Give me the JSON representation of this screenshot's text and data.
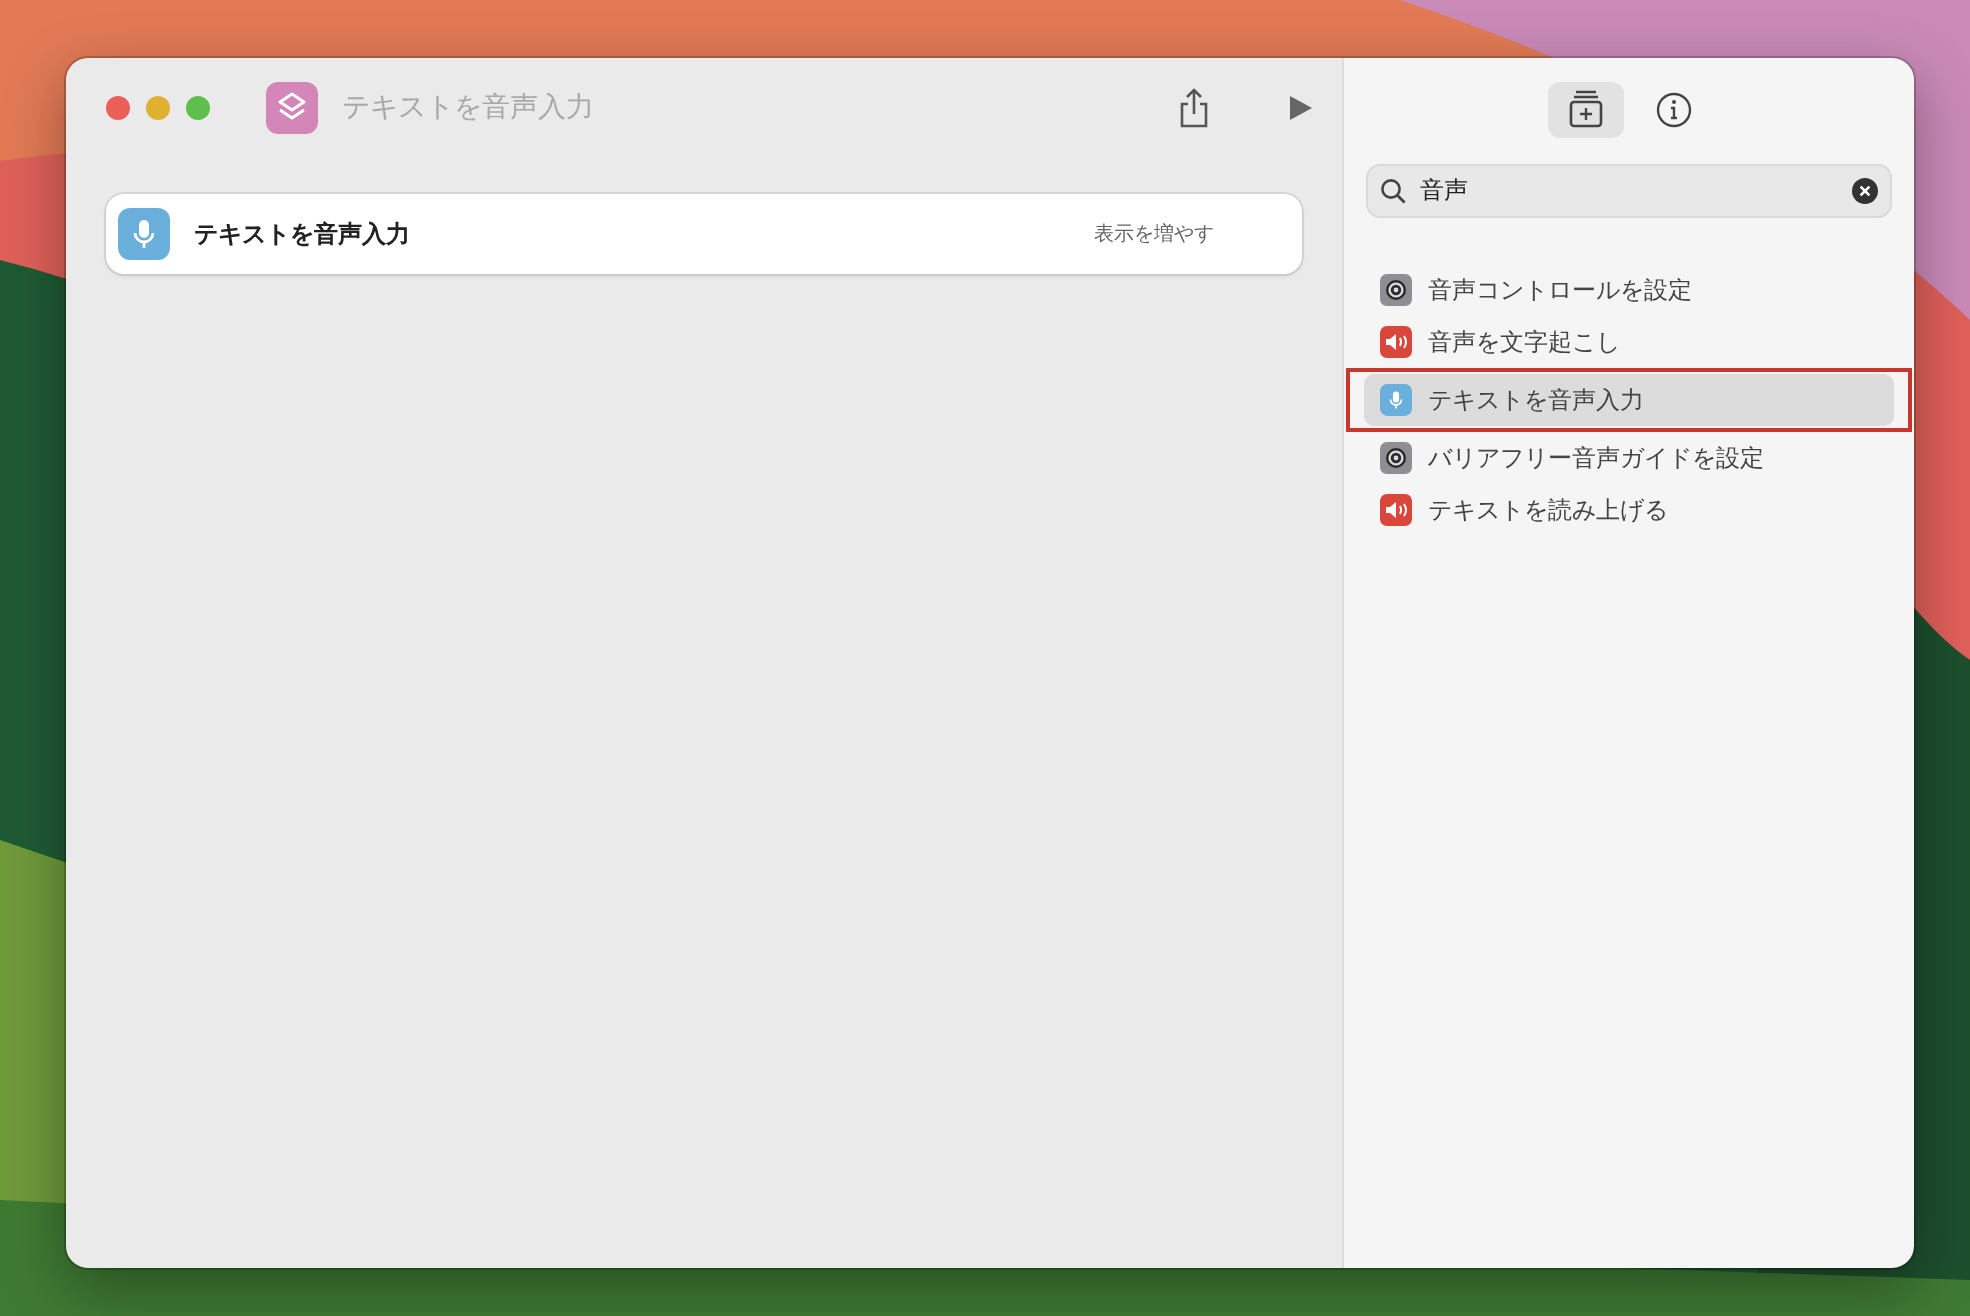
{
  "window": {
    "title": "テキストを音声入力"
  },
  "editor": {
    "actions": [
      {
        "title": "テキストを音声入力",
        "kind": "mic",
        "more": "表示を増やす"
      }
    ]
  },
  "sidebar": {
    "tabs": [
      {
        "kind": "library",
        "selected": true
      },
      {
        "kind": "info",
        "selected": false
      }
    ],
    "search": {
      "value": "音声"
    },
    "results": [
      {
        "label": "音声コントロールを設定",
        "kind": "gear",
        "selected": false,
        "annotated": false
      },
      {
        "label": "音声を文字起こし",
        "kind": "speaker",
        "selected": false,
        "annotated": false
      },
      {
        "label": "テキストを音声入力",
        "kind": "mic",
        "selected": true,
        "annotated": true
      },
      {
        "label": "バリアフリー音声ガイドを設定",
        "kind": "gear",
        "selected": false,
        "annotated": false
      },
      {
        "label": "テキストを読み上げる",
        "kind": "speaker",
        "selected": false,
        "annotated": false
      }
    ]
  }
}
